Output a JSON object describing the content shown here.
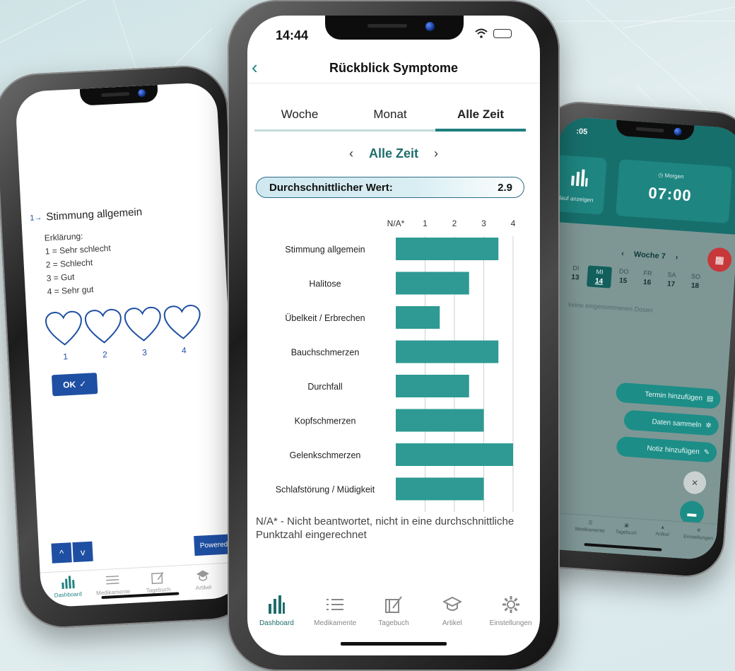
{
  "colors": {
    "accent": "#1f7f7f",
    "bar": "#2e9a93",
    "left_accent": "#1e4fa3",
    "right_header": "#176f6c",
    "calendar_button": "#c7383a"
  },
  "left_phone": {
    "question_number": "1",
    "question": "Stimmung allgemein",
    "explanation": [
      "Erklärung:",
      "1 = Sehr schlecht",
      "2 = Schlecht",
      "3 = Gut",
      "4 = Sehr gut"
    ],
    "heart_values": [
      "1",
      "2",
      "3",
      "4"
    ],
    "ok_label": "OK",
    "up_label": "^",
    "down_label": "v",
    "powered_label": "Powered by T",
    "tabs": [
      "Dashboard",
      "Medikamente",
      "Tagebuch",
      "Artikel"
    ],
    "tab_icons": [
      "chart-icon",
      "list-icon",
      "diary-icon",
      "cap-icon"
    ]
  },
  "center_phone": {
    "status_time": "14:44",
    "nav_title": "Rückblick Symptome",
    "segments": [
      "Woche",
      "Monat",
      "Alle Zeit"
    ],
    "active_segment": "Alle Zeit",
    "period_label": "Alle Zeit",
    "average_label": "Durchschnittlicher Wert:",
    "average_value": "2.9",
    "footnote": "N/A* - Nicht beantwortet, nicht in eine durchschnittliche Punktzahl eingerechnet",
    "tabs": [
      "Dashboard",
      "Medikamente",
      "Tagebuch",
      "Artikel",
      "Einstellungen"
    ],
    "tab_icons": [
      "chart-icon",
      "list-icon",
      "diary-icon",
      "cap-icon",
      "gear-icon"
    ]
  },
  "chart_data": {
    "type": "bar",
    "orientation": "horizontal",
    "categories": [
      "Stimmung allgemein",
      "Halitose",
      "Übelkeit / Erbrechen",
      "Bauchschmerzen",
      "Durchfall",
      "Kopfschmerzen",
      "Gelenkschmerzen",
      "Schlafstörung / Müdigkeit"
    ],
    "values": [
      3.5,
      2.5,
      1.5,
      3.5,
      2.5,
      3.0,
      4.0,
      3.0
    ],
    "tick_labels": [
      "N/A*",
      "1",
      "2",
      "3",
      "4"
    ],
    "xlim": [
      0,
      4
    ],
    "grid": true
  },
  "right_phone": {
    "status_time": ":05",
    "card_left_label": "erlauf anzeigen",
    "card_right_small": "Morgen",
    "card_right_time": "07:00",
    "week_label": "Woche 7",
    "days": [
      {
        "d": "DI",
        "n": "13"
      },
      {
        "d": "MI",
        "n": "14"
      },
      {
        "d": "DO",
        "n": "15"
      },
      {
        "d": "FR",
        "n": "16"
      },
      {
        "d": "SA",
        "n": "17"
      },
      {
        "d": "SO",
        "n": "18"
      }
    ],
    "selected_day": "14",
    "no_doses": "keine eingenommenen Dosen",
    "actions": [
      "Termin hinzufügen",
      "Daten sammeln",
      "Notiz hinzufügen"
    ],
    "close_label": "×",
    "tabs": [
      "rd",
      "Medikamente",
      "Tagebuch",
      "Artikel",
      "Einstellungen"
    ]
  }
}
